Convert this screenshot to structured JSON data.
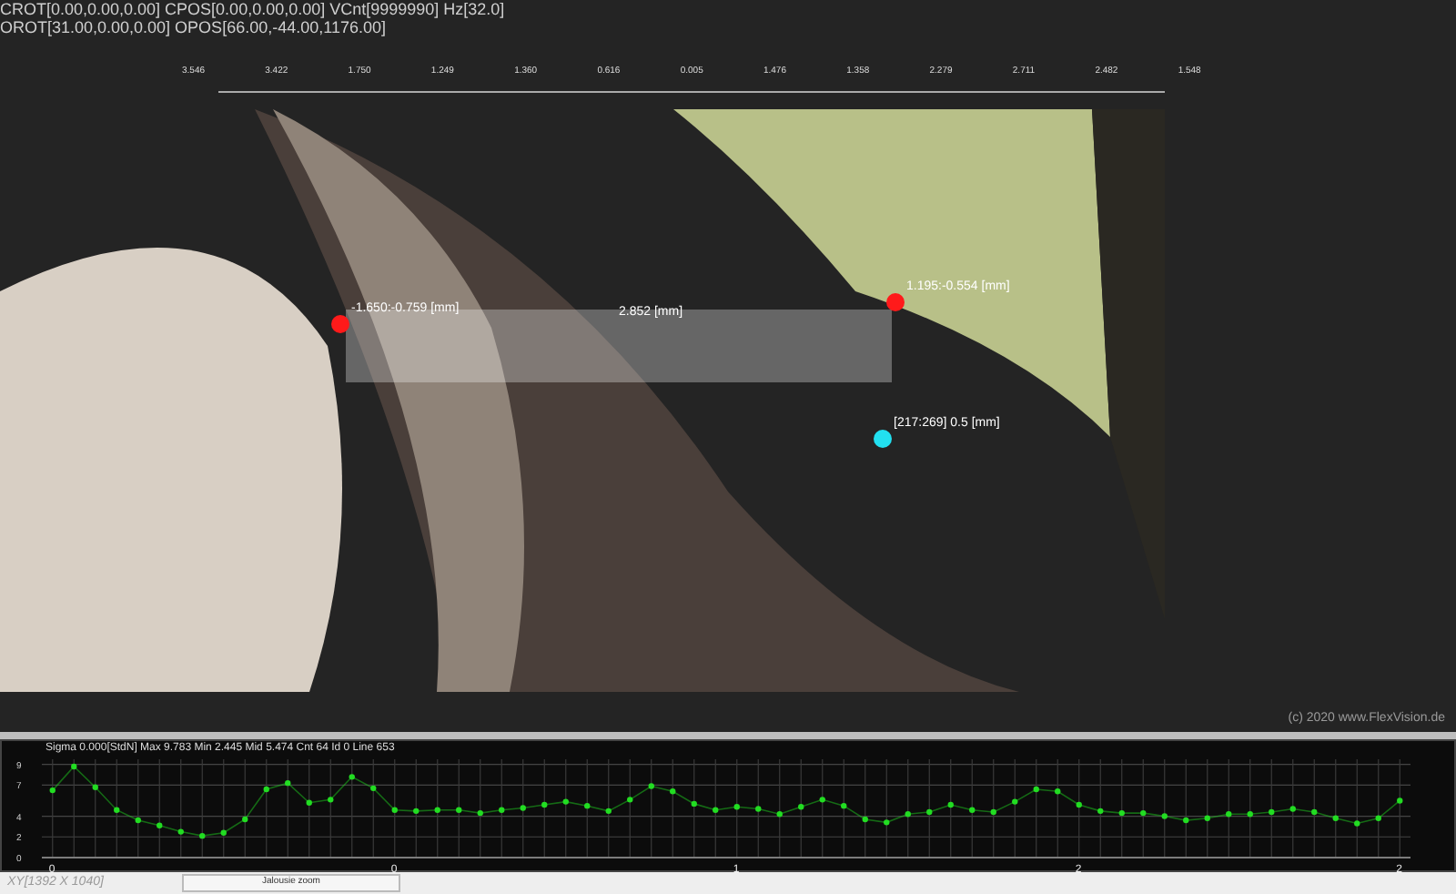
{
  "header": {
    "lines": [
      "CROT[0.00,0.00,0.00] CPOS[0.00,0.00,0.00] VCnt[9999990] Hz[32.0]",
      "OROT[31.00,0.00,0.00] OPOS[66.00,-44.00,1176.00]"
    ]
  },
  "view": {
    "top_axis_labels": [
      "3.546",
      "3.422",
      "1.750",
      "1.249",
      "1.360",
      "0.616",
      "0.005",
      "1.476",
      "1.358",
      "2.279",
      "2.711",
      "2.482",
      "1.548"
    ],
    "measurements": [
      {
        "kind": "point",
        "label": "-1.650:-0.759 [mm]",
        "color": "#ff1a1a"
      },
      {
        "kind": "distance",
        "label": "2.852 [mm]"
      },
      {
        "kind": "point",
        "label": "1.195:-0.554 [mm]",
        "color": "#ff1a1a"
      },
      {
        "kind": "point",
        "label": "[217:269] 0.5 [mm]",
        "color": "#22e0f0"
      }
    ],
    "copyright": "(c) 2020 www.FlexVision.de"
  },
  "profile": {
    "stats": "Sigma 0.000[StdN] Max 9.783 Min 2.445 Mid 5.474 Cnt 64 Id 0 Line 653",
    "chart_data": {
      "type": "line",
      "grid": true,
      "ylim": [
        0,
        9.5
      ],
      "yticks": [
        {
          "value": 0,
          "label": "0"
        },
        {
          "value": 2,
          "label": "2"
        },
        {
          "value": 4,
          "label": "4"
        },
        {
          "value": 7,
          "label": "7"
        },
        {
          "value": 9,
          "label": "9"
        }
      ],
      "categories": [
        "0",
        null,
        null,
        null,
        null,
        null,
        null,
        null,
        null,
        null,
        null,
        null,
        null,
        null,
        null,
        null,
        "0",
        null,
        null,
        null,
        null,
        null,
        null,
        null,
        null,
        null,
        null,
        null,
        null,
        null,
        null,
        null,
        "1",
        null,
        null,
        null,
        null,
        null,
        null,
        null,
        null,
        null,
        null,
        null,
        null,
        null,
        null,
        null,
        "2",
        null,
        null,
        null,
        null,
        null,
        null,
        null,
        null,
        null,
        null,
        null,
        null,
        null,
        null,
        "2"
      ],
      "series": [
        {
          "color": "#22dd22",
          "marker": "circle",
          "values": [
            6.5,
            8.8,
            6.8,
            4.6,
            3.6,
            3.1,
            2.5,
            2.1,
            2.4,
            3.7,
            6.6,
            7.2,
            5.3,
            5.6,
            7.8,
            6.7,
            4.6,
            4.5,
            4.6,
            4.6,
            4.3,
            4.6,
            4.8,
            5.1,
            5.4,
            5.0,
            4.5,
            5.6,
            6.9,
            6.4,
            5.2,
            4.6,
            4.9,
            4.7,
            4.2,
            4.9,
            5.6,
            5.0,
            3.7,
            3.4,
            4.2,
            4.4,
            5.1,
            4.6,
            4.4,
            5.4,
            6.6,
            6.4,
            5.1,
            4.5,
            4.3,
            4.3,
            4.0,
            3.6,
            3.8,
            4.2,
            4.2,
            4.4,
            4.7,
            4.4,
            3.8,
            3.3,
            3.8,
            5.5
          ]
        }
      ]
    }
  },
  "status_bar": {
    "resolution": "XY[1392 X 1040]",
    "button": "Jalousie zoom"
  }
}
